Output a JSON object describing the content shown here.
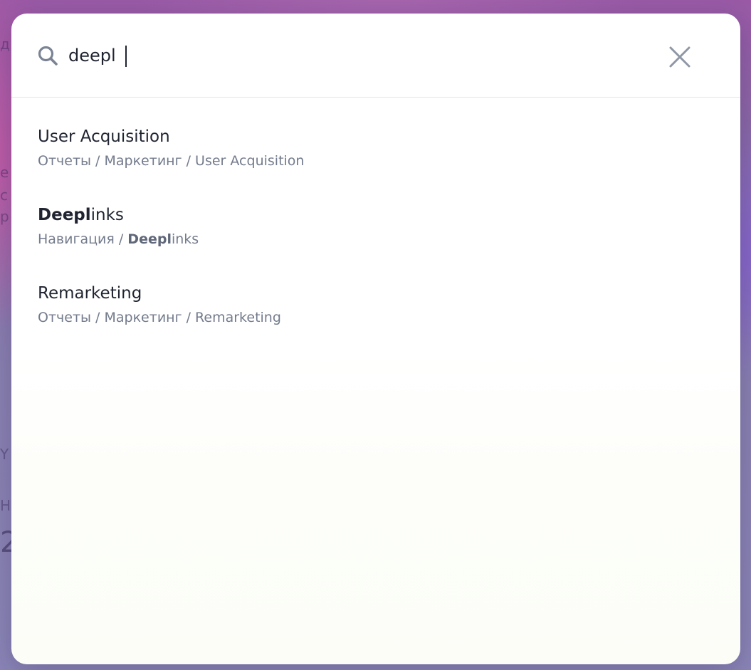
{
  "search": {
    "query": "deepl",
    "highlight": "Deepl"
  },
  "results": [
    {
      "title": "User Acquisition",
      "path_prefix": "Отчеты / Маркетинг / User Acquisition",
      "path_match": "",
      "path_rest": ""
    },
    {
      "title_match": "Deepl",
      "title_rest": "inks",
      "path_prefix": "Навигация / ",
      "path_match": "Deepl",
      "path_rest": "inks"
    },
    {
      "title": "Remarketing",
      "path_prefix": "Отчеты / Маркетинг / Remarketing",
      "path_match": "",
      "path_rest": ""
    }
  ],
  "background_fragments": [
    "д",
    "е",
    "с",
    "р",
    "Y",
    "Н",
    "2"
  ],
  "colors": {
    "text_primary": "#1f2430",
    "text_secondary": "#737b8c",
    "icon": "#7b8494",
    "divider": "#e3e5ea"
  },
  "icons": {
    "search": "search-icon",
    "close": "close-icon"
  }
}
